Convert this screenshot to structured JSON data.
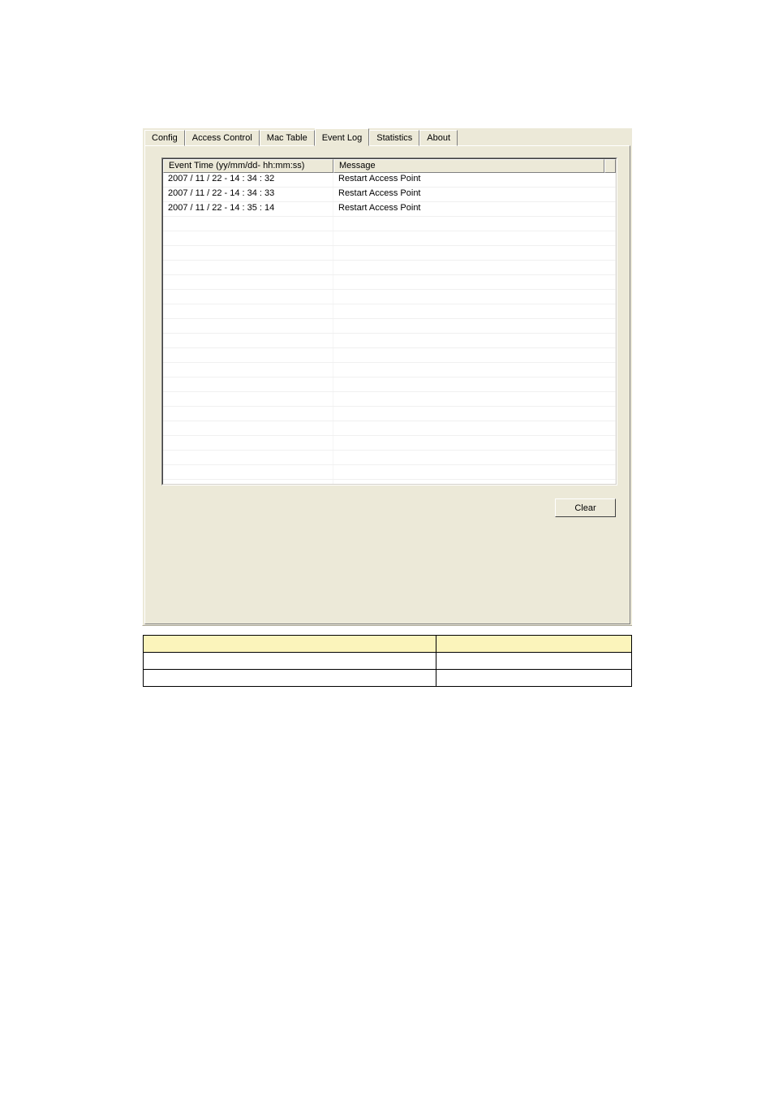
{
  "tabs": [
    {
      "label": "Config",
      "active": false
    },
    {
      "label": "Access Control",
      "active": false
    },
    {
      "label": "Mac Table",
      "active": false
    },
    {
      "label": "Event Log",
      "active": true
    },
    {
      "label": "Statistics",
      "active": false
    },
    {
      "label": "About",
      "active": false
    }
  ],
  "listview": {
    "columns": [
      "Event Time (yy/mm/dd- hh:mm:ss)",
      "Message"
    ],
    "rows": [
      {
        "time": "2007 / 11 / 22 - 14 : 34 : 32",
        "message": "Restart Access Point"
      },
      {
        "time": "2007 / 11 / 22 - 14 : 34 : 33",
        "message": "Restart Access Point"
      },
      {
        "time": "2007 / 11 / 22 - 14 : 35 : 14",
        "message": "Restart Access Point"
      }
    ]
  },
  "buttons": {
    "clear": "Clear"
  }
}
